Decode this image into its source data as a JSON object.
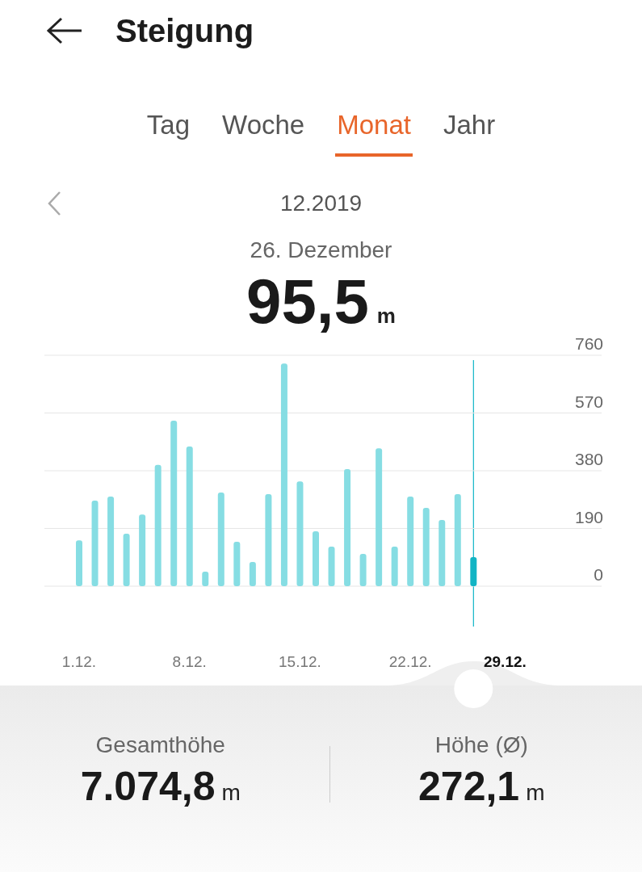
{
  "header": {
    "title": "Steigung"
  },
  "tabs": [
    {
      "label": "Tag",
      "selected": false
    },
    {
      "label": "Woche",
      "selected": false
    },
    {
      "label": "Monat",
      "selected": true
    },
    {
      "label": "Jahr",
      "selected": false
    }
  ],
  "period": {
    "label": "12.2019"
  },
  "selection": {
    "date": "26. Dezember",
    "value": "95,5",
    "unit": "m"
  },
  "chart": {
    "chart_data": {
      "type": "bar",
      "categories": [
        "1.12.",
        null,
        null,
        null,
        null,
        null,
        null,
        "8.12.",
        null,
        null,
        null,
        null,
        null,
        null,
        "15.12.",
        null,
        null,
        null,
        null,
        null,
        null,
        "22.12.",
        null,
        null,
        null,
        null,
        null,
        "29.12.",
        null,
        null,
        null
      ],
      "series": [
        {
          "color": "#86dde3",
          "values": [
            151,
            282,
            295,
            173,
            236,
            399,
            545,
            460,
            48,
            308,
            146,
            80,
            303,
            733,
            345,
            181,
            130,
            385,
            106,
            454,
            130,
            295,
            258,
            218,
            303,
            null,
            null,
            null,
            null,
            null,
            null
          ]
        },
        {
          "color": "#12b4c4",
          "values": [
            null,
            null,
            null,
            null,
            null,
            null,
            null,
            null,
            null,
            null,
            null,
            null,
            null,
            null,
            null,
            null,
            null,
            null,
            null,
            null,
            null,
            null,
            null,
            null,
            null,
            95.5,
            null,
            null,
            null,
            null,
            null
          ]
        }
      ],
      "ylim": [
        0,
        760
      ],
      "grid": true,
      "yticks": [
        0,
        190,
        380,
        570,
        760
      ]
    }
  },
  "stats": [
    {
      "label": "Gesamthöhe",
      "value": "7.074,8",
      "unit": "m"
    },
    {
      "label": "Höhe (Ø)",
      "value": "272,1",
      "unit": "m"
    }
  ]
}
